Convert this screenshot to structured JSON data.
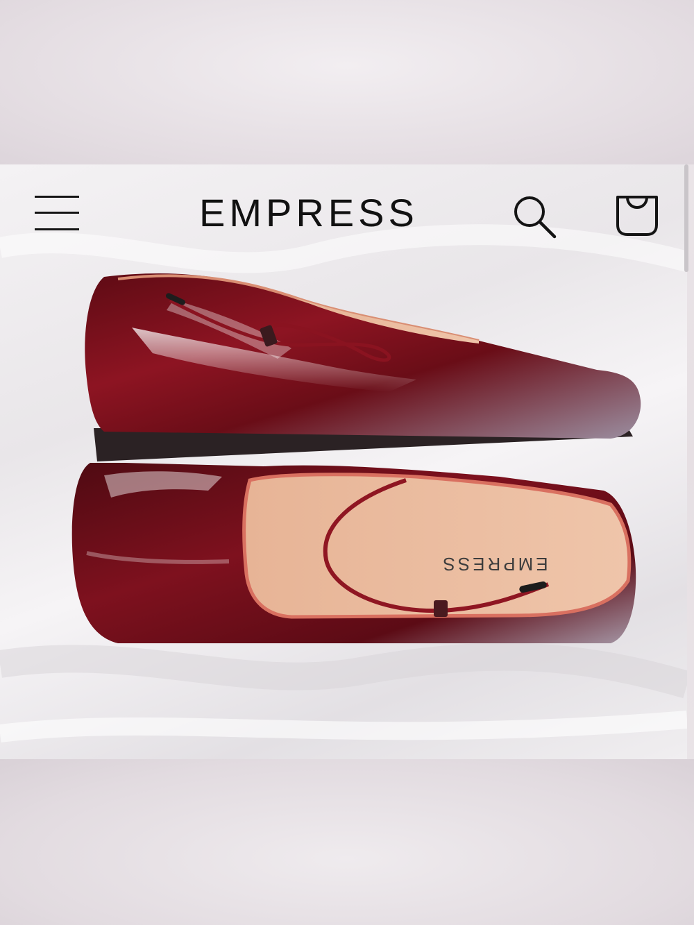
{
  "header": {
    "brand": "EMPRESS",
    "menu_icon": "hamburger-menu-icon",
    "search_icon": "search-icon",
    "cart_icon": "shopping-bag-icon"
  },
  "product_image": {
    "insole_print": "EMPRESS",
    "shoe_color": "#7a0f1c",
    "lining_color": "#e9b79a"
  }
}
